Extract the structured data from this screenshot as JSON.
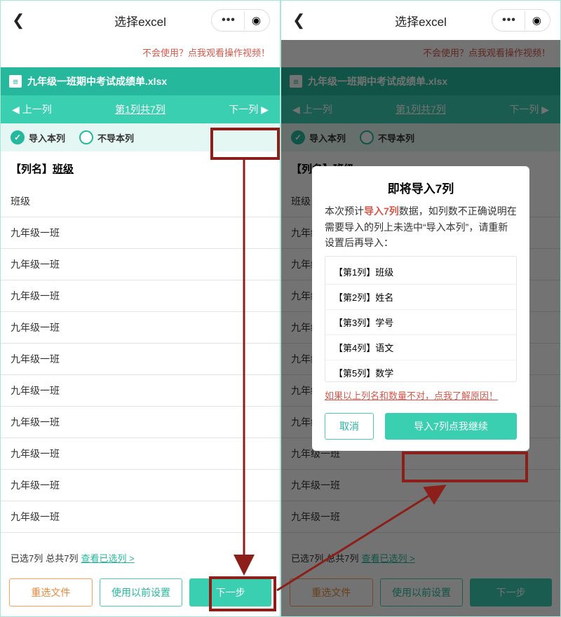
{
  "header": {
    "title": "选择excel",
    "help_text": "不会使用？点我观看操作视频！"
  },
  "file": {
    "name": "九年级一班期中考试成绩单.xlsx"
  },
  "col_nav": {
    "prev": "上一列",
    "center": "第1列共7列",
    "next": "下一列"
  },
  "choice": {
    "import": "导入本列",
    "skip": "不导本列"
  },
  "column": {
    "prefix": "【列名】",
    "name": "班级"
  },
  "rows": [
    "班级",
    "九年级一班",
    "九年级一班",
    "九年级一班",
    "九年级一班",
    "九年级一班",
    "九年级一班",
    "九年级一班",
    "九年级一班",
    "九年级一班",
    "九年级一班",
    "九年级一班"
  ],
  "footer": {
    "status_a": "已选7列",
    "status_b": "总共7列",
    "see": "查看已选列 >"
  },
  "buttons": {
    "reselect": "重选文件",
    "use_prev": "使用以前设置",
    "next": "下一步"
  },
  "modal": {
    "title": "即将导入7列",
    "desc_a": "本次预计",
    "desc_emph": "导入7列",
    "desc_b": "数据，如列数不正确说明在需要导入的列上未选中“导入本列”，请重新设置后再导入：",
    "cols": [
      "【第1列】班级",
      "【第2列】姓名",
      "【第3列】学号",
      "【第4列】语文",
      "【第5列】数学"
    ],
    "warn": "如果以上列名和数量不对，点我了解原因！",
    "cancel": "取消",
    "continue": "导入7列点我继续"
  }
}
